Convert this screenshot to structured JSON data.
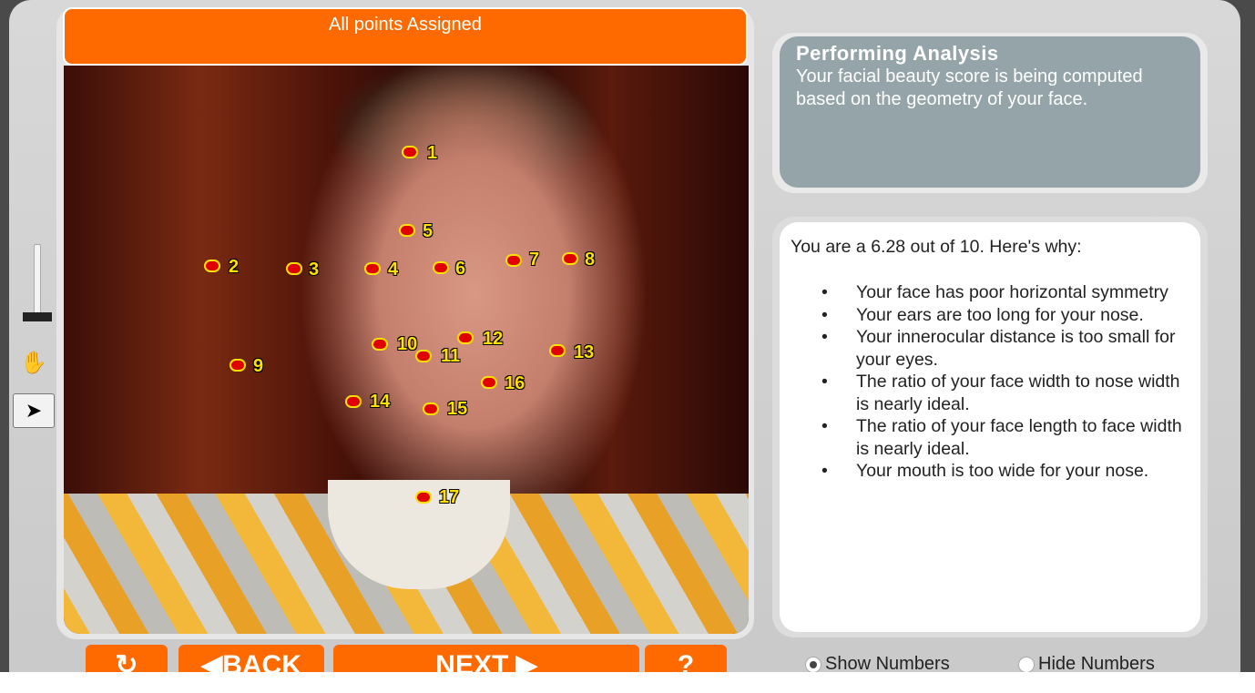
{
  "status_bar": {
    "text": "All points Assigned"
  },
  "markers": [
    {
      "num": "1"
    },
    {
      "num": "2"
    },
    {
      "num": "3"
    },
    {
      "num": "4"
    },
    {
      "num": "5"
    },
    {
      "num": "6"
    },
    {
      "num": "7"
    },
    {
      "num": "8"
    },
    {
      "num": "9"
    },
    {
      "num": "10"
    },
    {
      "num": "11"
    },
    {
      "num": "12"
    },
    {
      "num": "13"
    },
    {
      "num": "14"
    },
    {
      "num": "15"
    },
    {
      "num": "16"
    },
    {
      "num": "17"
    }
  ],
  "analysis": {
    "title": "Performing Analysis",
    "text": "Your facial beauty score is being computed based on the geometry of your face."
  },
  "result": {
    "intro": "You are a 6.28 out of 10.  Here's why:",
    "bullet": "•",
    "reasons": [
      "Your face has poor horizontal symmetry",
      "Your ears are too long for your nose.",
      "Your innerocular distance is too small for your eyes.",
      "The ratio of your face width to nose width is nearly ideal.",
      "The ratio of your face length to face width is nearly ideal.",
      "Your mouth is too wide for your nose."
    ]
  },
  "buttons": {
    "refresh": "↻",
    "back": "◀BACK",
    "next": "NEXT ▶",
    "help": "?"
  },
  "options": {
    "show_numbers": "Show Numbers",
    "hide_numbers": "Hide Numbers",
    "selected": "show_numbers"
  },
  "tools": {
    "pointer": "➤",
    "hand": "✋"
  }
}
